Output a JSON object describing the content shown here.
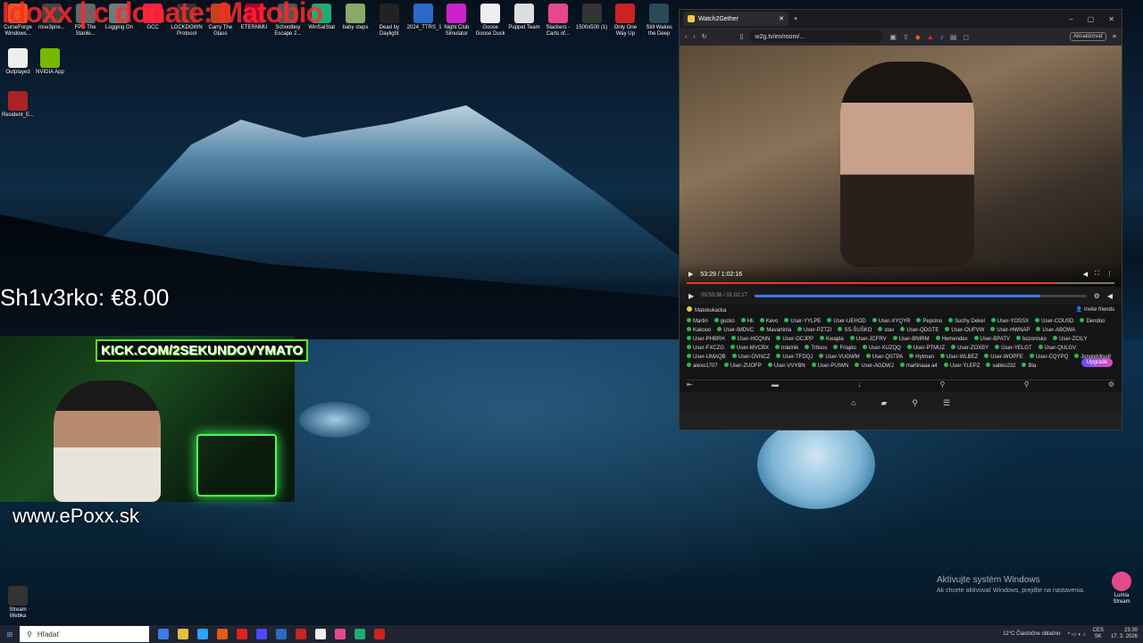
{
  "desktop": {
    "overlay_title": "Idoxx | c donate: Matobio",
    "icons": [
      {
        "label": "CurseForge Windows...",
        "color": "#e25a1c"
      },
      {
        "label": "rose3pne...",
        "color": "#444"
      },
      {
        "label": "FPD The Stanle...",
        "color": "#666"
      },
      {
        "label": "Logging On",
        "color": "#777"
      },
      {
        "label": "GCC",
        "color": "#e24"
      },
      {
        "label": "LOCKDOWN Protocol",
        "color": "#333"
      },
      {
        "label": "Carry The Glass",
        "color": "#c7421c"
      },
      {
        "label": "ETERNMU",
        "color": "#a03"
      },
      {
        "label": "Schoolboy Escape 2...",
        "color": "#555"
      },
      {
        "label": "WinSalStat",
        "color": "#2a7"
      },
      {
        "label": "baby steps",
        "color": "#8a6"
      },
      {
        "label": "Dead by Daylight",
        "color": "#222"
      },
      {
        "label": "2024_TTRS_1",
        "color": "#2a6ac7"
      },
      {
        "label": "Night Club Simulator",
        "color": "#c2c"
      },
      {
        "label": "Goose Goose Duck",
        "color": "#eee"
      },
      {
        "label": "Puppet Team",
        "color": "#ddd"
      },
      {
        "label": "Slackers - Carts of...",
        "color": "#e44a8a"
      },
      {
        "label": "1500x500 (1)",
        "color": "#333"
      },
      {
        "label": "Only One Way Up",
        "color": "#c22"
      },
      {
        "label": "Still Wakes the Deep",
        "color": "#2a4a5a"
      }
    ],
    "side_icons": [
      {
        "label": "Outplayed",
        "color": "#eee"
      },
      {
        "label": "NVIDIA App",
        "color": "#76b900"
      },
      {
        "label": "Resident_E...",
        "color": "#a22"
      }
    ],
    "stream_icon": "Stream Webka",
    "lumia_icon": "Lumia Stream"
  },
  "overlay": {
    "donation": "Sh1v3rko: €8.00",
    "kick": "KICK.COM/2SEKUNDOVYMATO",
    "website": "www.ePoxx.sk"
  },
  "browser": {
    "tab_title": "Watch2Gether",
    "url": "w2g.tv/en/room/...",
    "update_label": "Aktualizovať",
    "window_controls": [
      "–",
      "▢",
      "✕"
    ],
    "video": {
      "time": "53:29 / 1:02:16",
      "progress": 0.86
    },
    "sync": {
      "time": "00:53:38 / 01:02:17",
      "progress": 0.86
    },
    "room_name": "Matokukacka",
    "invite_label": "Invite friends",
    "upgrade_label": "Upgrade",
    "users": [
      "Martin",
      "gucko",
      "Hli",
      "Kevo",
      "User-YYLPE",
      "User-UEHOD",
      "User-XYQYR",
      "Pepcino",
      "Suchy Dekel",
      "User-YOSSX",
      "User-COUSD",
      "Dendoo",
      "Kakooo",
      "User-IMDVC",
      "Mavartinla",
      "User-PZTZI",
      "SS-ŠUŠKO",
      "stav",
      "User-QDGTE",
      "User-OUFVW",
      "User-HWNAP",
      "User-ABOWA",
      "User-PHBRH",
      "User-HCQNN",
      "User-OCJPP",
      "Kwajda",
      "User-JCFRV",
      "User-BNIRM",
      "Hemendex",
      "User-BPATV",
      "bozonisko",
      "User-ZCILY",
      "User-FXCZG",
      "User-MVCBX",
      "trdelnik",
      "Trtloos",
      "Frlajdo",
      "User-XUZQQ",
      "User-PTMUZ",
      "User-ZOXBY",
      "User-YELGT",
      "User-QULGV",
      "User-UMAQB",
      "User-OVNCZ",
      "User-TFDQJ",
      "User-VUGWM",
      "User-QSTPA",
      "Hytman",
      "User-WLBEZ",
      "User-WOPFE",
      "User-CQYPQ",
      "JungleMiso8",
      "alexo1707",
      "User-ZUOFP",
      "User-VVYBN",
      "User-PUIWN",
      "User-AGDWJ",
      "martinaaa a4",
      "User-YLEPZ",
      "sabko232",
      "Bla"
    ]
  },
  "windows": {
    "activate_title": "Aktivujte systém Windows",
    "activate_sub": "Ak chcete aktivovať Windows, prejdite na nastavenia."
  },
  "taskbar": {
    "search_placeholder": "Hľadať",
    "weather": "12°C Čiastočne oblačno",
    "lang": "CES\nSK",
    "time": "23:30",
    "date": "17. 3. 2026",
    "apps": [
      "#3b7ce8",
      "#e0c040",
      "#2aa3ff",
      "#e25a1c",
      "#d22",
      "#4a4aff",
      "#2a6ac7",
      "#c22",
      "#eee",
      "#e44a8a",
      "#2a7",
      "#c22"
    ]
  }
}
